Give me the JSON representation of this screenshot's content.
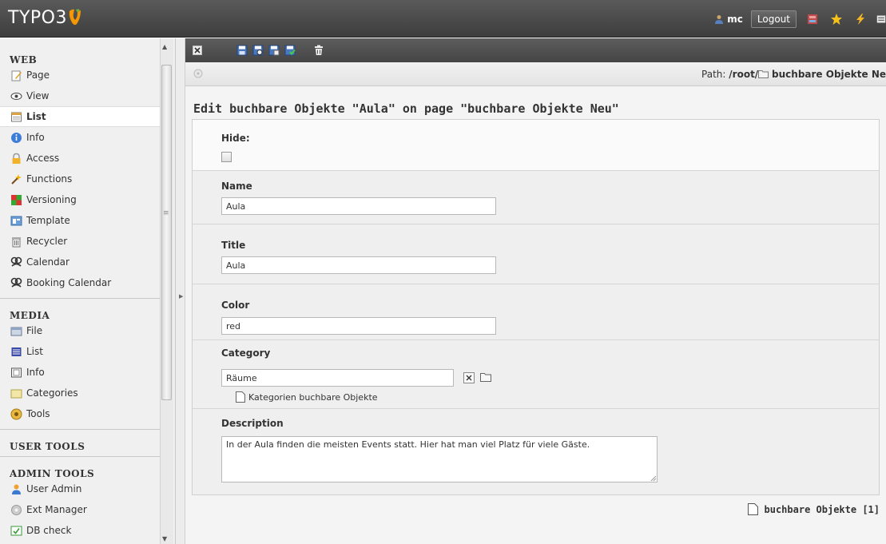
{
  "topbar": {
    "logo": "TYPO3",
    "user": "mc",
    "logout_label": "Logout"
  },
  "modmenu": {
    "groups": [
      {
        "title": "WEB",
        "items": [
          {
            "label": "Page",
            "icon": "page-icon"
          },
          {
            "label": "View",
            "icon": "view-icon"
          },
          {
            "label": "List",
            "icon": "list-icon",
            "active": true
          },
          {
            "label": "Info",
            "icon": "info-icon"
          },
          {
            "label": "Access",
            "icon": "lock-icon"
          },
          {
            "label": "Functions",
            "icon": "wand-icon"
          },
          {
            "label": "Versioning",
            "icon": "versioning-icon"
          },
          {
            "label": "Template",
            "icon": "template-icon"
          },
          {
            "label": "Recycler",
            "icon": "recycler-icon"
          },
          {
            "label": "Calendar",
            "icon": "calendar-icon"
          },
          {
            "label": "Booking Calendar",
            "icon": "booking-calendar-icon"
          }
        ]
      },
      {
        "title": "MEDIA",
        "items": [
          {
            "label": "File",
            "icon": "file-icon"
          },
          {
            "label": "List",
            "icon": "list-icon"
          },
          {
            "label": "Info",
            "icon": "info-icon"
          },
          {
            "label": "Categories",
            "icon": "categories-icon"
          },
          {
            "label": "Tools",
            "icon": "tools-icon"
          }
        ]
      },
      {
        "title": "USER TOOLS",
        "items": []
      },
      {
        "title": "ADMIN TOOLS",
        "items": [
          {
            "label": "User Admin",
            "icon": "user-admin-icon"
          },
          {
            "label": "Ext Manager",
            "icon": "ext-manager-icon"
          },
          {
            "label": "DB check",
            "icon": "db-check-icon"
          }
        ]
      }
    ]
  },
  "path": {
    "label": "Path:",
    "root": "/root/",
    "page": "buchbare Objekte Ne"
  },
  "form": {
    "title": "Edit buchbare Objekte \"Aula\" on page \"buchbare Objekte Neu\"",
    "hide_label": "Hide:",
    "name_label": "Name",
    "name_value": "Aula",
    "title_label": "Title",
    "title_value": "Aula",
    "color_label": "Color",
    "color_value": "red",
    "category_label": "Category",
    "category_value": "Räume",
    "category_tree": "Kategorien buchbare Objekte",
    "description_label": "Description",
    "description_value": "In der Aula finden die meisten Events statt. Hier hat man viel Platz für viele Gäste."
  },
  "record_ref": "buchbare Objekte [1]",
  "colors": {
    "topbar": "#4a4a4a",
    "typo3_orange": "#f49700",
    "menu_bg": "#f0f0f0"
  }
}
